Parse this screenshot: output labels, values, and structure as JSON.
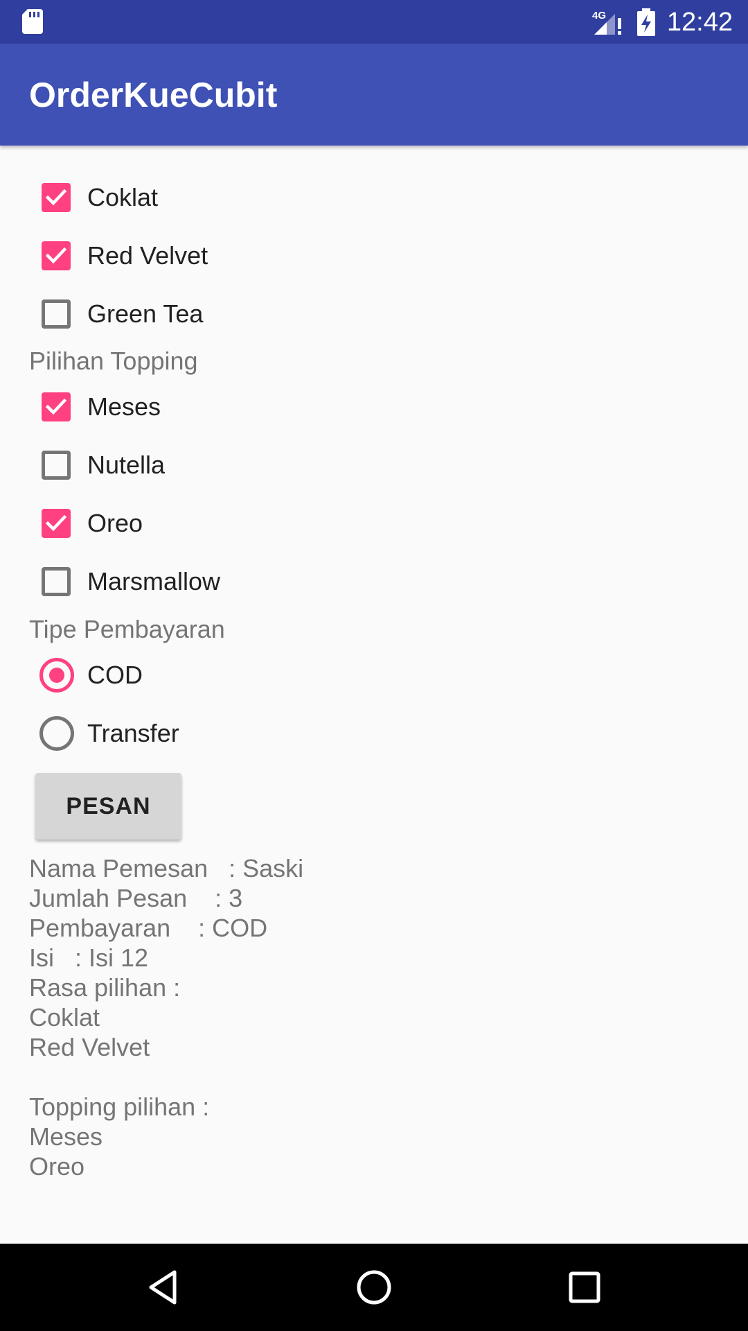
{
  "status_bar": {
    "time": "12:42",
    "network": "4G",
    "icons": [
      "sd-card-icon",
      "signal-icon",
      "battery-charging-icon"
    ]
  },
  "app_bar": {
    "title": "OrderKueCubit"
  },
  "flavors": [
    {
      "label": "Coklat",
      "checked": true
    },
    {
      "label": "Red Velvet",
      "checked": true
    },
    {
      "label": "Green Tea",
      "checked": false
    }
  ],
  "topping_section": {
    "label": "Pilihan Topping"
  },
  "toppings": [
    {
      "label": "Meses",
      "checked": true
    },
    {
      "label": "Nutella",
      "checked": false
    },
    {
      "label": "Oreo",
      "checked": true
    },
    {
      "label": "Marsmallow",
      "checked": false
    }
  ],
  "payment_section": {
    "label": "Tipe Pembayaran"
  },
  "payment_options": [
    {
      "label": "COD",
      "selected": true
    },
    {
      "label": "Transfer",
      "selected": false
    }
  ],
  "order_button": {
    "label": "PESAN"
  },
  "summary": {
    "lines": [
      "Nama Pemesan   : Saski",
      "Jumlah Pesan    : 3",
      "Pembayaran    : COD",
      "Isi   : Isi 12",
      "Rasa pilihan :",
      "Coklat",
      "Red Velvet",
      "",
      "Topping pilihan :",
      "Meses",
      "Oreo"
    ]
  },
  "nav_bar": {
    "icons": [
      "back-icon",
      "home-icon",
      "recents-icon"
    ]
  },
  "colors": {
    "status_bar": "#303f9f",
    "app_bar": "#3f51b5",
    "accent": "#ff4081",
    "background": "#fafafa",
    "secondary_text": "#757575"
  }
}
